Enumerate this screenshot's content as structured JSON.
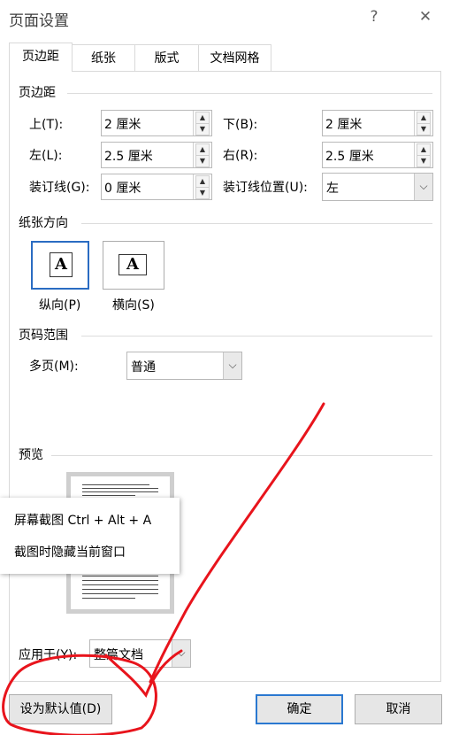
{
  "dialog": {
    "title": "页面设置",
    "help_label": "?",
    "close_label": "✕"
  },
  "tabs": [
    {
      "label": "页边距"
    },
    {
      "label": "纸张"
    },
    {
      "label": "版式"
    },
    {
      "label": "文档网格"
    }
  ],
  "margins": {
    "heading": "页边距",
    "top_label": "上(T):",
    "top_value": "2 厘米",
    "bottom_label": "下(B):",
    "bottom_value": "2 厘米",
    "left_label": "左(L):",
    "left_value": "2.5 厘米",
    "right_label": "右(R):",
    "right_value": "2.5 厘米",
    "gutter_label": "装订线(G):",
    "gutter_value": "0 厘米",
    "gutter_pos_label": "装订线位置(U):",
    "gutter_pos_value": "左"
  },
  "orientation": {
    "heading": "纸张方向",
    "portrait_label": "纵向(P)",
    "landscape_label": "横向(S)",
    "glyph": "A"
  },
  "pages": {
    "heading": "页码范围",
    "multi_label": "多页(M):",
    "multi_value": "普通"
  },
  "preview": {
    "heading": "预览"
  },
  "tooltip": {
    "item1": "屏幕截图 Ctrl + Alt + A",
    "item2": "截图时隐藏当前窗口"
  },
  "apply": {
    "label": "应用于(Y):",
    "value": "整篇文档"
  },
  "buttons": {
    "set_default": "设为默认值(D)",
    "ok": "确定",
    "cancel": "取消"
  },
  "colors": {
    "accent": "#2a78d0",
    "annotation": "#e8141c"
  }
}
